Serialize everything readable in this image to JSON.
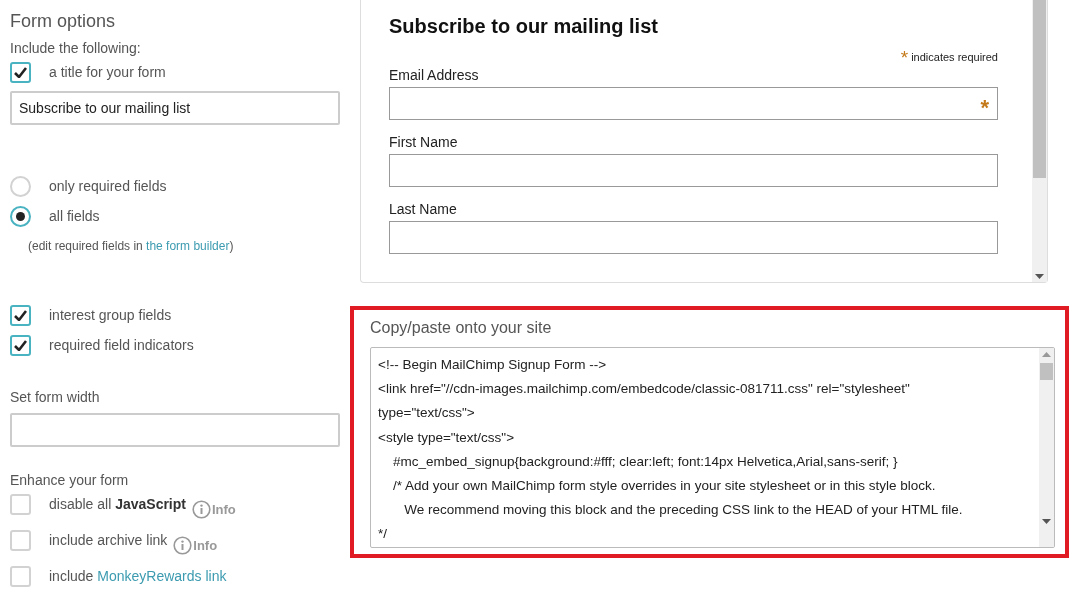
{
  "options": {
    "title": "Form options",
    "include_label": "Include the following:",
    "title_option": {
      "label": "a title for your form",
      "checked": true
    },
    "title_value": "Subscribe to our mailing list",
    "field_radios": [
      {
        "label": "only required fields",
        "selected": false
      },
      {
        "label": "all fields",
        "selected": true
      }
    ],
    "radio_note": {
      "prefix": "(edit required fields in ",
      "link": "the form builder",
      "suffix": ")"
    },
    "checkboxes": [
      {
        "label": "interest group fields",
        "checked": true
      },
      {
        "label": "required field indicators",
        "checked": true
      }
    ],
    "width_label": "Set form width",
    "enhance_label": "Enhance your form",
    "enhance_options": [
      {
        "label": "disable all **JavaScript**",
        "checked": false,
        "info": "Info"
      },
      {
        "label": "include archive link",
        "checked": false,
        "info": "Info"
      },
      {
        "label": "include",
        "link": "MonkeyRewards link",
        "checked": false
      }
    ]
  },
  "preview": {
    "title": "Subscribe to our mailing list",
    "required_note": {
      "mark": "*",
      "text": "indicates required"
    },
    "fields": [
      {
        "label": "Email Address",
        "mark": "*"
      },
      {
        "label": "First Name"
      },
      {
        "label": "Last Name"
      }
    ]
  },
  "embed": {
    "title": "Copy/paste onto your site",
    "code_lines": [
      "<!-- Begin MailChimp Signup Form -->",
      "<link href=\"//cdn-images.mailchimp.com/embedcode/classic-081711.css\" rel=\"stylesheet\"",
      "type=\"text/css\">",
      "<style type=\"text/css\">",
      "\t#mc_embed_signup{background:#fff; clear:left; font:14px Helvetica,Arial,sans-serif; }",
      "\t/* Add your own MailChimp form style overrides in your site stylesheet or in this style block.",
      "\t   We recommend moving this block and the preceding CSS link to the HEAD of your HTML file.",
      "*/"
    ]
  }
}
